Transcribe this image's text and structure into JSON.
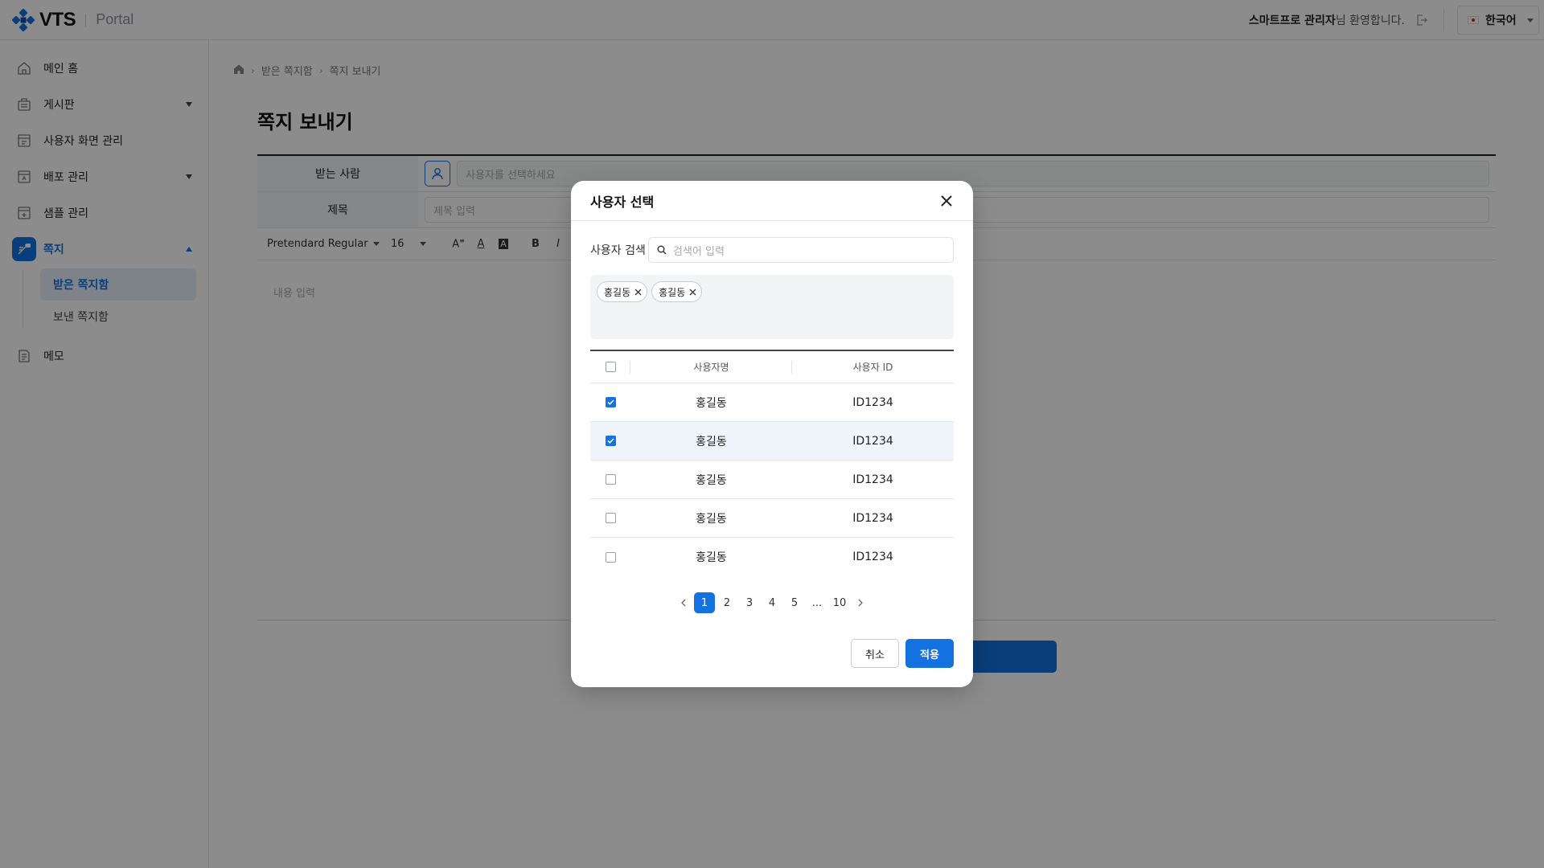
{
  "header": {
    "logo_text": "VTS",
    "logo_portal": "Portal",
    "welcome_name": "스마트프로 관리자",
    "welcome_suffix": "님 환영합니다.",
    "language": "한국어",
    "brand_color": "#1371e0"
  },
  "sidebar": {
    "items": [
      {
        "label": "메인 홈",
        "icon": "home-icon"
      },
      {
        "label": "게시판",
        "icon": "board-icon"
      },
      {
        "label": "사용자 화면 관리",
        "icon": "screen-icon"
      },
      {
        "label": "배포 관리",
        "icon": "deploy-icon"
      },
      {
        "label": "샘플 관리",
        "icon": "sample-icon"
      },
      {
        "label": "쪽지",
        "icon": "message-icon"
      },
      {
        "label": "메모",
        "icon": "memo-icon"
      }
    ],
    "sub_items": [
      {
        "label": "받은 쪽지함"
      },
      {
        "label": "보낸 쪽지함"
      }
    ]
  },
  "main": {
    "breadcrumb": [
      "받은 쪽지함",
      "쪽지 보내기"
    ],
    "title": "쪽지 보내기",
    "form": {
      "recipient_label": "받는 사람",
      "recipient_placeholder": "사용자를 선택하세요",
      "subject_label": "제목",
      "subject_placeholder": "제목 입력",
      "font_name": "Pretendard Regular",
      "font_size": "16",
      "content_placeholder": "내용 입력"
    }
  },
  "modal": {
    "title": "사용자 선택",
    "search_label": "사용자 검색",
    "search_placeholder": "검색어 입력",
    "chips": [
      "홍길동",
      "홍길동"
    ],
    "columns": {
      "name": "사용자명",
      "id": "사용자 ID"
    },
    "rows": [
      {
        "name": "홍길동",
        "id": "ID1234",
        "checked": true
      },
      {
        "name": "홍길동",
        "id": "ID1234",
        "checked": true
      },
      {
        "name": "홍길동",
        "id": "ID1234",
        "checked": false
      },
      {
        "name": "홍길동",
        "id": "ID1234",
        "checked": false
      },
      {
        "name": "홍길동",
        "id": "ID1234",
        "checked": false
      }
    ],
    "pages": [
      "1",
      "2",
      "3",
      "4",
      "5",
      "...",
      "10"
    ],
    "current_page": "1",
    "cancel_label": "취소",
    "apply_label": "적용"
  }
}
